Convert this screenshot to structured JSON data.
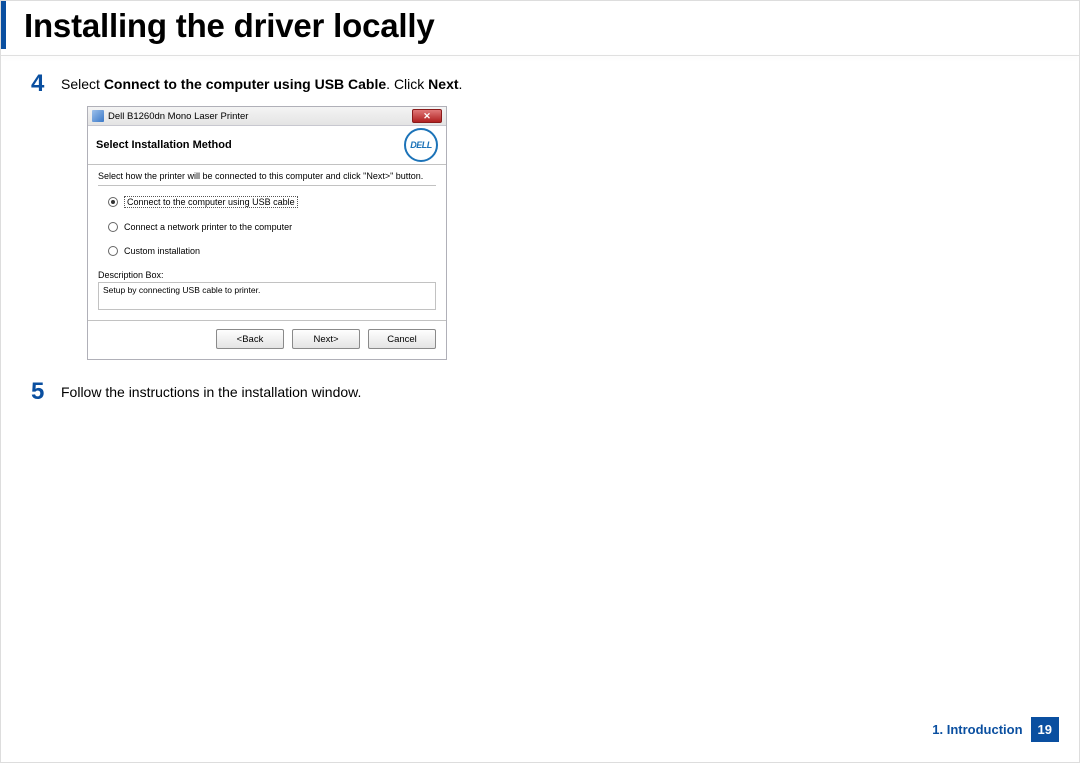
{
  "heading": "Installing the driver locally",
  "steps": {
    "s4": {
      "num": "4",
      "pre": "Select ",
      "bold1": "Connect to the computer using USB Cable",
      "mid": ". Click ",
      "bold2": "Next",
      "post": "."
    },
    "s5": {
      "num": "5",
      "text": "Follow the instructions in the installation window."
    }
  },
  "installer": {
    "window_title": "Dell B1260dn Mono Laser Printer",
    "close_glyph": "✕",
    "header_title": "Select Installation Method",
    "logo_text": "DELL",
    "instruction": "Select how the printer will be connected to this computer and click \"Next>\" button.",
    "options": {
      "usb": "Connect to the computer using  USB cable",
      "net": "Connect a network printer to the computer",
      "custom": "Custom installation"
    },
    "descbox_label": "Description Box:",
    "descbox_text": "Setup by connecting USB cable to printer.",
    "buttons": {
      "back": "<Back",
      "next": "Next>",
      "cancel": "Cancel"
    }
  },
  "footer": {
    "section": "1. Introduction",
    "page": "19"
  }
}
